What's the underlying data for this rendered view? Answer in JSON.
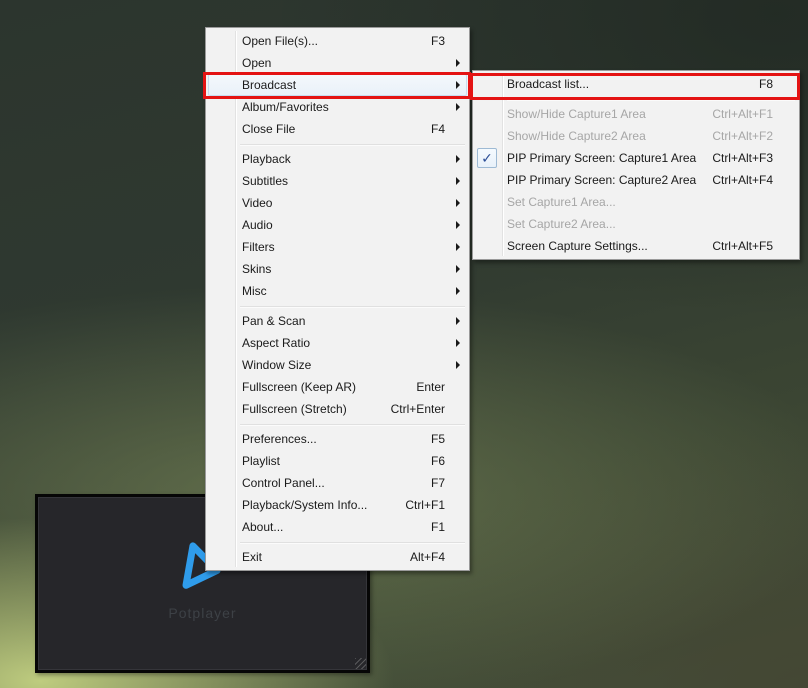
{
  "app": {
    "name": "PotPlayer",
    "context": "right-click context menu with Broadcast submenu open"
  },
  "colors": {
    "annotation_red": "#e41313",
    "menu_background": "#f2f2f2",
    "disabled_text": "#a6a6a6",
    "check_blue": "#2b4d96",
    "logo_blue": "#2f9ceb"
  },
  "main_menu": {
    "items": [
      {
        "name": "open-files",
        "label": "Open File(s)...",
        "shortcut": "F3"
      },
      {
        "name": "open",
        "label": "Open",
        "arrow": true
      },
      {
        "name": "broadcast",
        "label": "Broadcast",
        "arrow": true,
        "fade": true,
        "annotated": true
      },
      {
        "name": "album-favorites",
        "label": "Album/Favorites",
        "arrow": true
      },
      {
        "name": "close-file",
        "label": "Close File",
        "shortcut": "F4"
      },
      {
        "separator": true
      },
      {
        "name": "playback",
        "label": "Playback",
        "arrow": true
      },
      {
        "name": "subtitles",
        "label": "Subtitles",
        "arrow": true
      },
      {
        "name": "video",
        "label": "Video",
        "arrow": true
      },
      {
        "name": "audio",
        "label": "Audio",
        "arrow": true
      },
      {
        "name": "filters",
        "label": "Filters",
        "arrow": true
      },
      {
        "name": "skins",
        "label": "Skins",
        "arrow": true
      },
      {
        "name": "misc",
        "label": "Misc",
        "arrow": true
      },
      {
        "separator": true
      },
      {
        "name": "pan-scan",
        "label": "Pan & Scan",
        "arrow": true
      },
      {
        "name": "aspect-ratio",
        "label": "Aspect Ratio",
        "arrow": true
      },
      {
        "name": "window-size",
        "label": "Window Size",
        "arrow": true
      },
      {
        "name": "fullscreen-keep-ar",
        "label": "Fullscreen (Keep AR)",
        "shortcut": "Enter"
      },
      {
        "name": "fullscreen-stretch",
        "label": "Fullscreen (Stretch)",
        "shortcut": "Ctrl+Enter"
      },
      {
        "separator": true
      },
      {
        "name": "preferences",
        "label": "Preferences...",
        "shortcut": "F5"
      },
      {
        "name": "playlist",
        "label": "Playlist",
        "shortcut": "F6"
      },
      {
        "name": "control-panel",
        "label": "Control Panel...",
        "shortcut": "F7"
      },
      {
        "name": "playback-system-info",
        "label": "Playback/System Info...",
        "shortcut": "Ctrl+F1"
      },
      {
        "name": "about",
        "label": "About...",
        "shortcut": "F1"
      },
      {
        "separator": true
      },
      {
        "name": "exit",
        "label": "Exit",
        "shortcut": "Alt+F4"
      }
    ]
  },
  "submenu": {
    "items": [
      {
        "name": "broadcast-list",
        "label": "Broadcast list...",
        "shortcut": "F8",
        "annotated": true
      },
      {
        "separator": true
      },
      {
        "name": "show-hide-capture1-area",
        "label": "Show/Hide Capture1 Area",
        "shortcut": "Ctrl+Alt+F1",
        "disabled": true
      },
      {
        "name": "show-hide-capture2-area",
        "label": "Show/Hide Capture2 Area",
        "shortcut": "Ctrl+Alt+F2",
        "disabled": true
      },
      {
        "name": "pip-primary-screen-capture1-area",
        "label": "PIP Primary Screen:  Capture1 Area",
        "shortcut": "Ctrl+Alt+F3",
        "checked": true
      },
      {
        "name": "pip-primary-screen-capture2-area",
        "label": "PIP Primary Screen:  Capture2 Area",
        "shortcut": "Ctrl+Alt+F4"
      },
      {
        "name": "set-capture1-area",
        "label": "Set Capture1 Area...",
        "disabled": true
      },
      {
        "name": "set-capture2-area",
        "label": "Set Capture2 Area...",
        "disabled": true
      },
      {
        "name": "screen-capture-settings",
        "label": "Screen Capture Settings...",
        "shortcut": "Ctrl+Alt+F5"
      }
    ]
  },
  "player_window": {
    "logo_text": "Potplayer",
    "logo_icon": "play-triangle-icon",
    "check_glyph": "✓"
  }
}
